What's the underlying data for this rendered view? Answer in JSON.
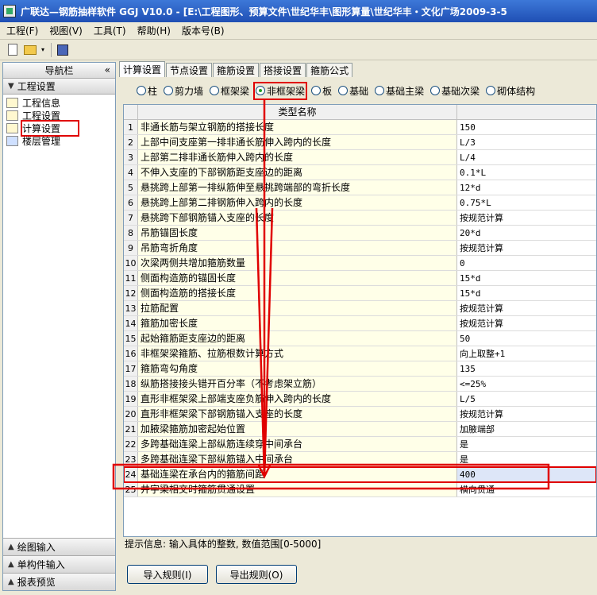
{
  "window": {
    "title": "广联达—钢筋抽样软件 GGJ V10.0 - [E:\\工程图形、预算文件\\世纪华丰\\图形算量\\世纪华丰・文化广场2009-3-5"
  },
  "menu": [
    "工程(F)",
    "视图(V)",
    "工具(T)",
    "帮助(H)",
    "版本号(B)"
  ],
  "nav": {
    "header": "导航栏",
    "collapse": "«",
    "section": "工程设置",
    "items": [
      {
        "label": "工程信息",
        "icon": "info-doc-icon"
      },
      {
        "label": "工程设置",
        "icon": "settings-doc-icon"
      },
      {
        "label": "计算设置",
        "icon": "calc-settings-icon"
      },
      {
        "label": "楼层管理",
        "icon": "floor-manage-icon"
      }
    ],
    "bottom": [
      "绘图输入",
      "单构件输入",
      "报表预览"
    ]
  },
  "tabs": [
    "计算设置",
    "节点设置",
    "箍筋设置",
    "搭接设置",
    "箍筋公式"
  ],
  "radios": [
    "柱",
    "剪力墙",
    "框架梁",
    "非框架梁",
    "板",
    "基础",
    "基础主梁",
    "基础次梁",
    "砌体结构"
  ],
  "grid": {
    "header": "类型名称",
    "rows": [
      {
        "no": "1",
        "name": "非通长筋与架立钢筋的搭接长度",
        "value": "150"
      },
      {
        "no": "2",
        "name": "上部中间支座第一排非通长筋伸入跨内的长度",
        "value": "L/3"
      },
      {
        "no": "3",
        "name": "上部第二排非通长筋伸入跨内的长度",
        "value": "L/4"
      },
      {
        "no": "4",
        "name": "不伸入支座的下部钢筋距支座边的距离",
        "value": "0.1*L"
      },
      {
        "no": "5",
        "name": "悬挑跨上部第一排纵筋伸至悬挑跨端部的弯折长度",
        "value": "12*d"
      },
      {
        "no": "6",
        "name": "悬挑跨上部第二排钢筋伸入跨内的长度",
        "value": "0.75*L"
      },
      {
        "no": "7",
        "name": "悬挑跨下部钢筋锚入支座的长度",
        "value": "按规范计算"
      },
      {
        "no": "8",
        "name": "吊筋锚固长度",
        "value": "20*d"
      },
      {
        "no": "9",
        "name": "吊筋弯折角度",
        "value": "按规范计算"
      },
      {
        "no": "10",
        "name": "次梁两侧共增加箍筋数量",
        "value": "0"
      },
      {
        "no": "11",
        "name": "侧面构造筋的锚固长度",
        "value": "15*d"
      },
      {
        "no": "12",
        "name": "侧面构造筋的搭接长度",
        "value": "15*d"
      },
      {
        "no": "13",
        "name": "拉筋配置",
        "value": "按规范计算"
      },
      {
        "no": "14",
        "name": "箍筋加密长度",
        "value": "按规范计算"
      },
      {
        "no": "15",
        "name": "起始箍筋距支座边的距离",
        "value": "50"
      },
      {
        "no": "16",
        "name": "非框架梁箍筋、拉筋根数计算方式",
        "value": "向上取整+1"
      },
      {
        "no": "17",
        "name": "箍筋弯勾角度",
        "value": "135"
      },
      {
        "no": "18",
        "name": "纵筋搭接接头错开百分率（不考虑架立筋）",
        "value": "<=25%"
      },
      {
        "no": "19",
        "name": "直形非框架梁上部端支座负筋伸入跨内的长度",
        "value": "L/5"
      },
      {
        "no": "20",
        "name": "直形非框架梁下部钢筋锚入支座的长度",
        "value": "按规范计算"
      },
      {
        "no": "21",
        "name": "加腋梁箍筋加密起始位置",
        "value": "加腋端部"
      },
      {
        "no": "22",
        "name": "多跨基础连梁上部纵筋连续穿中间承台",
        "value": "是"
      },
      {
        "no": "23",
        "name": "多跨基础连梁下部纵筋锚入中间承台",
        "value": "是"
      },
      {
        "no": "24",
        "name": "基础连梁在承台内的箍筋间距",
        "value": "400"
      },
      {
        "no": "25",
        "name": "井字梁相交时箍筋贯通设置",
        "value": "横向贯通"
      }
    ]
  },
  "hint": "提示信息: 输入具体的整数, 数值范围[0-5000]",
  "buttons": [
    "导入规则(I)",
    "导出规则(O)"
  ],
  "annotation_color": "#e00000"
}
